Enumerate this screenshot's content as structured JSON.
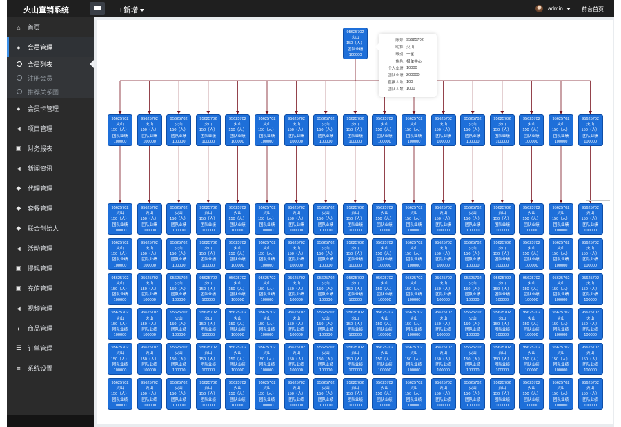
{
  "header": {
    "brand": "火山直销系统",
    "add_label": "+新增",
    "user": "admin",
    "front_link": "前台首页"
  },
  "sidebar": {
    "items": [
      {
        "label": "首页",
        "icon": "home-icon"
      },
      {
        "label": "会员管理",
        "icon": "user-icon",
        "active": true,
        "children": [
          {
            "label": "会员列表",
            "active": true
          },
          {
            "label": "注册会员"
          },
          {
            "label": "推荐关系图"
          }
        ]
      },
      {
        "label": "会员卡管理",
        "icon": "user-icon"
      },
      {
        "label": "项目管理",
        "icon": "bullhorn-icon"
      },
      {
        "label": "财务报表",
        "icon": "money-icon"
      },
      {
        "label": "新闻资讯",
        "icon": "bullhorn-icon"
      },
      {
        "label": "代理管理",
        "icon": "users-icon"
      },
      {
        "label": "套餐管理",
        "icon": "users-icon"
      },
      {
        "label": "联合创始人",
        "icon": "users-icon"
      },
      {
        "label": "活动管理",
        "icon": "bullhorn-icon"
      },
      {
        "label": "提现管理",
        "icon": "money-icon"
      },
      {
        "label": "充值管理",
        "icon": "money-icon"
      },
      {
        "label": "视频管理",
        "icon": "bullhorn-icon"
      },
      {
        "label": "商品管理",
        "icon": "tag-icon"
      },
      {
        "label": "订单管理",
        "icon": "list-icon"
      },
      {
        "label": "系统设置",
        "icon": "bars-icon"
      }
    ]
  },
  "tree": {
    "root": {
      "lines": [
        "95625702",
        "火山",
        "150（人）",
        "团队业绩",
        "100000"
      ]
    },
    "node": {
      "lines": [
        "95625702",
        "火山",
        "150（人）",
        "团队业绩",
        "100000"
      ]
    },
    "level1_count": 17,
    "level2_columns": 17,
    "level2_rows": 6
  },
  "tooltip": {
    "rows": [
      {
        "k": "账号:",
        "v": "95625702"
      },
      {
        "k": "昵称:",
        "v": "火山"
      },
      {
        "k": "级别:",
        "v": "一星"
      },
      {
        "k": "角色:",
        "v": "报单中心"
      },
      {
        "k": "个人业绩:",
        "v": "10000"
      },
      {
        "k": "团队业绩:",
        "v": "200000"
      },
      {
        "k": "直推人数:",
        "v": "100"
      },
      {
        "k": "团队人数:",
        "v": "1000"
      }
    ]
  },
  "colors": {
    "node": "#1e6fd9",
    "link": "#7a1420",
    "sidebar": "#2b2b2b",
    "topbar": "#1f1f1f"
  }
}
